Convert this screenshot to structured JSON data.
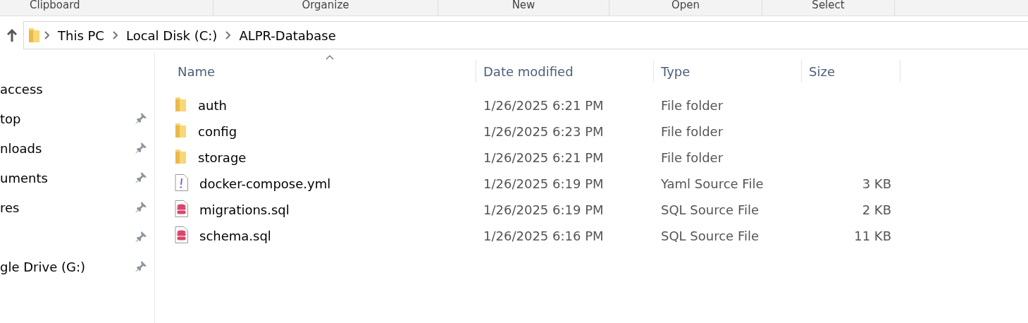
{
  "ribbon": {
    "groups": [
      "Clipboard",
      "Organize",
      "New",
      "Open",
      "Select"
    ]
  },
  "address_bar": {
    "crumbs": [
      "This PC",
      "Local Disk (C:)",
      "ALPR-Database"
    ]
  },
  "sidebar": {
    "items": [
      {
        "label": "access",
        "pinned": false
      },
      {
        "label": "top",
        "pinned": true
      },
      {
        "label": "nloads",
        "pinned": true
      },
      {
        "label": "uments",
        "pinned": true
      },
      {
        "label": "res",
        "pinned": true
      },
      {
        "pinned": true
      },
      {
        "label": "gle Drive (G:)",
        "pinned": true
      }
    ]
  },
  "table": {
    "columns": [
      {
        "label": "Name",
        "sorted": true
      },
      {
        "label": "Date modified",
        "sorted": false
      },
      {
        "label": "Type",
        "sorted": false
      },
      {
        "label": "Size",
        "sorted": false
      }
    ],
    "rows": [
      {
        "kind": "folder",
        "name": "auth",
        "date": "1/26/2025 6:21 PM",
        "type": "File folder"
      },
      {
        "kind": "folder",
        "name": "config",
        "date": "1/26/2025 6:23 PM",
        "type": "File folder"
      },
      {
        "kind": "folder",
        "name": "storage",
        "date": "1/26/2025 6:21 PM",
        "type": "File folder"
      },
      {
        "kind": "yaml",
        "name": "docker-compose.yml",
        "date": "1/26/2025 6:19 PM",
        "type": "Yaml Source File",
        "size": "3 KB"
      },
      {
        "kind": "sql",
        "name": "migrations.sql",
        "date": "1/26/2025 6:19 PM",
        "type": "SQL Source File",
        "size": "2 KB"
      },
      {
        "kind": "sql",
        "name": "schema.sql",
        "date": "1/26/2025 6:16 PM",
        "type": "SQL Source File",
        "size": "11 KB"
      }
    ]
  }
}
